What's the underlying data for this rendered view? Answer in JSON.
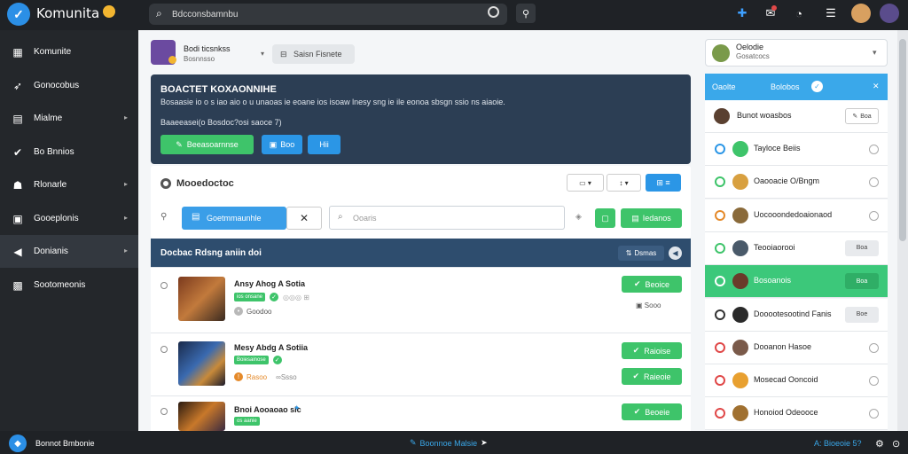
{
  "topbar": {
    "brand": "Komunita",
    "search_value": "Bdcconsbamnbu",
    "icons": [
      "puzzle-icon",
      "notifications-icon",
      "chat-icon",
      "list-icon"
    ]
  },
  "sidebar": {
    "items": [
      {
        "label": "Komunite",
        "icon": "home-icon",
        "caret": false
      },
      {
        "label": "Gonocobus",
        "icon": "rocket-icon",
        "caret": false
      },
      {
        "label": "Mialme",
        "icon": "stack-icon",
        "caret": true
      },
      {
        "label": "Bo Bnnios",
        "icon": "check-icon",
        "caret": false
      },
      {
        "label": "Rlonarle",
        "icon": "people-icon",
        "caret": true
      },
      {
        "label": "Gooeplonis",
        "icon": "layers-icon",
        "caret": true
      },
      {
        "label": "Donianis",
        "icon": "back-icon",
        "caret": true,
        "active": true
      },
      {
        "label": "Sootomeonis",
        "icon": "grid-icon",
        "caret": false
      }
    ]
  },
  "profile": {
    "title": "Bodi ticsnkss",
    "subtitle": "Bosnnsso",
    "dropdown": "Saisn Fisnete"
  },
  "hero": {
    "title": "BOACTET KOXAONNIHE",
    "desc": "Bosaasie io o s iao aio o u unaoas ie eoane ios isoaw lnesy sng ie ile eonoa sbsgn ssio ns aiaoie.",
    "sub": "Baaeeasei(o Bosdoc?osi saoce 7)",
    "btn_primary": "Beeasoarnnse",
    "btn_secondary": "Boo",
    "btn_tertiary": "Hii"
  },
  "section": {
    "title": "Mooedoctoc",
    "filter_chip": "Goetmmaunhle",
    "search_placeholder": "Ooaris",
    "add_button": "Iedanos"
  },
  "list_header": {
    "title": "Docbac Rdsng aniin doi",
    "sort": "Dsmas"
  },
  "rows": [
    {
      "title": "Ansy Ahog A Sotia",
      "tag": "ios onsane",
      "meta": "Goodoo",
      "secondary": "",
      "action": "Beoice",
      "count": "Sooo"
    },
    {
      "title": "Mesy Abdg A Sotiia",
      "tag": "Boiesainose",
      "meta": "Rasoo",
      "secondary": "Ssso",
      "action": "Raioise",
      "action2": "Raieoie"
    },
    {
      "title": "Bnoi Aooaoao sic",
      "tag": "os aanie",
      "meta": "",
      "secondary": "",
      "action": "Beoeie"
    }
  ],
  "right": {
    "user_name": "Oelodie",
    "user_sub": "Gosatcocs",
    "tab_left": "Oaolte",
    "tab_right": "Bolobos",
    "first_label": "Bunot woasbos",
    "first_button": "Boa",
    "items": [
      {
        "label": "Tayloce Beiis",
        "color": "#2b96e6",
        "control": "radio"
      },
      {
        "label": "Oaooacie O/Bngm",
        "color": "#3ec46a",
        "control": "radio"
      },
      {
        "label": "Uocooondedoaionaod",
        "color": "#e58a2a",
        "control": "radio"
      },
      {
        "label": "Teooiaorooi",
        "color": "#3ec46a",
        "control": "button",
        "button": "Boa"
      },
      {
        "label": "Bosoanois",
        "color": "#ffffff",
        "control": "button",
        "button": "Boa",
        "highlight": true
      },
      {
        "label": "Dooootesootind Fanis",
        "color": "#333333",
        "control": "button",
        "button": "Boe"
      },
      {
        "label": "Dooanon Hasoe",
        "color": "#e04848",
        "control": "radio"
      },
      {
        "label": "Mosecad Ooncoid",
        "color": "#e04848",
        "control": "radio"
      },
      {
        "label": "Honoiod Odeooce",
        "color": "#e04848",
        "control": "radio"
      }
    ]
  },
  "bottombar": {
    "left": "Bonnot Bmbonie",
    "center": "Boonnoe Malsie",
    "right": "A: Bioeoie 5?"
  },
  "colors": {
    "accent": "#2b96e6",
    "success": "#3ec46a",
    "dark": "#1f2226",
    "hero": "#2c3e54"
  }
}
